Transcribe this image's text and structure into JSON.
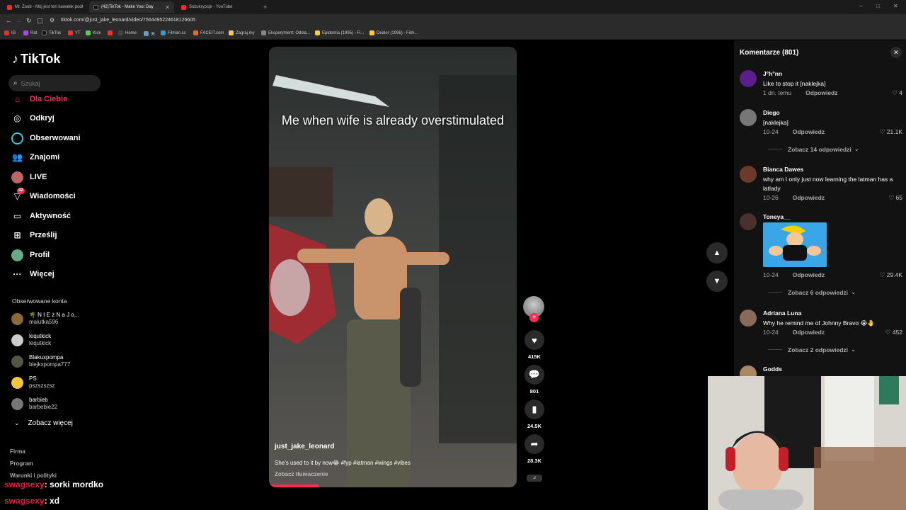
{
  "browser": {
    "tabs": [
      {
        "title": "Mr. Zoob - Mój jest ten kawałek podł"
      },
      {
        "title": "(42)TikTok - Make Your Day"
      },
      {
        "title": "Subskrypcje - YouTube"
      }
    ],
    "url": "tiktok.com/@just_jake_leonard/video/7564495224618126605",
    "bookmarks": [
      "IG",
      "Rat",
      "TikTok",
      "YT",
      "Kick",
      "Home",
      "天",
      "Filman.cc",
      "FACEIT.com",
      "Zagraj.my",
      "Eksperyment: Odsła...",
      "Epidemia (1995) - Fi...",
      "Dealer (1996) - Film..."
    ]
  },
  "sidebar": {
    "logo": "TikTok",
    "search_placeholder": "Szukaj",
    "nav": [
      {
        "label": "Dla Ciebie",
        "icon": "home-icon"
      },
      {
        "label": "Odkryj",
        "icon": "compass-icon"
      },
      {
        "label": "Obserwowani",
        "icon": "following-icon"
      },
      {
        "label": "Znajomi",
        "icon": "friends-icon"
      },
      {
        "label": "LIVE",
        "icon": "live-icon"
      },
      {
        "label": "Wiadomości",
        "icon": "messages-icon",
        "badge": "42"
      },
      {
        "label": "Aktywność",
        "icon": "activity-icon"
      },
      {
        "label": "Prześlij",
        "icon": "upload-icon"
      },
      {
        "label": "Profil",
        "icon": "profile-icon"
      },
      {
        "label": "Więcej",
        "icon": "more-icon"
      }
    ],
    "followed_title": "Obserwowane konta",
    "followed": [
      {
        "name": "🌴 N I E z N a J o...",
        "handle": "malutka596"
      },
      {
        "name": "lequtkick",
        "handle": "lequtkick"
      },
      {
        "name": "Blakuxpompa",
        "handle": "blejkxpompa777"
      },
      {
        "name": "PS",
        "handle": "pszszszsz"
      },
      {
        "name": "barbieb",
        "handle": "barbebie22"
      }
    ],
    "see_more": "Zobacz więcej",
    "footer": [
      "Firma",
      "Program",
      "Warunki i polityki"
    ]
  },
  "chat_overlay": [
    {
      "user": "swagsexy",
      "message": ": sorki mordko"
    },
    {
      "user": "swagsexy",
      "message": ": xd"
    }
  ],
  "video": {
    "caption": "Me when wife is already overstimulated",
    "username": "just_jake_leonard",
    "description": "She's used to it by now😂 #fyp #latman #wings #vibes",
    "translate": "Zobacz tłumaczenie",
    "progress_fraction": 0.2
  },
  "actions": {
    "likes": "415K",
    "comments": "801",
    "saves": "24.5K",
    "shares": "28.3K"
  },
  "comments": {
    "title": "Komentarze (801)",
    "items": [
      {
        "user": "J°h°nn",
        "text": "Like to stop it [naklejka]",
        "date": "1 dn. temu",
        "reply": "Odpowiedz",
        "likes": "4"
      },
      {
        "user": "Diego",
        "text": "[naklejka]",
        "date": "10-24",
        "reply": "Odpowiedz",
        "likes": "21.1K",
        "replies": "Zobacz 14 odpowiedzi"
      },
      {
        "user": "Bianca Dawes",
        "text": "why am I only just now learning the latman has a latlady",
        "date": "10-26",
        "reply": "Odpowiedz",
        "likes": "65"
      },
      {
        "user": "Toneya__",
        "text": "",
        "date": "10-24",
        "reply": "Odpowiedz",
        "likes": "29.4K",
        "replies": "Zobacz 6 odpowiedzi"
      },
      {
        "user": "Adriana Luna",
        "text": "Why he remind me of Johnny Bravo 😭🤚",
        "date": "10-24",
        "reply": "Odpowiedz",
        "likes": "452",
        "replies": "Zobacz 2 odpowiedzi"
      },
      {
        "user": "Godds",
        "text": ""
      }
    ]
  },
  "colors": {
    "accent": "#fe2c55",
    "chat_user": "#e51a3f",
    "panel": "#121212"
  }
}
